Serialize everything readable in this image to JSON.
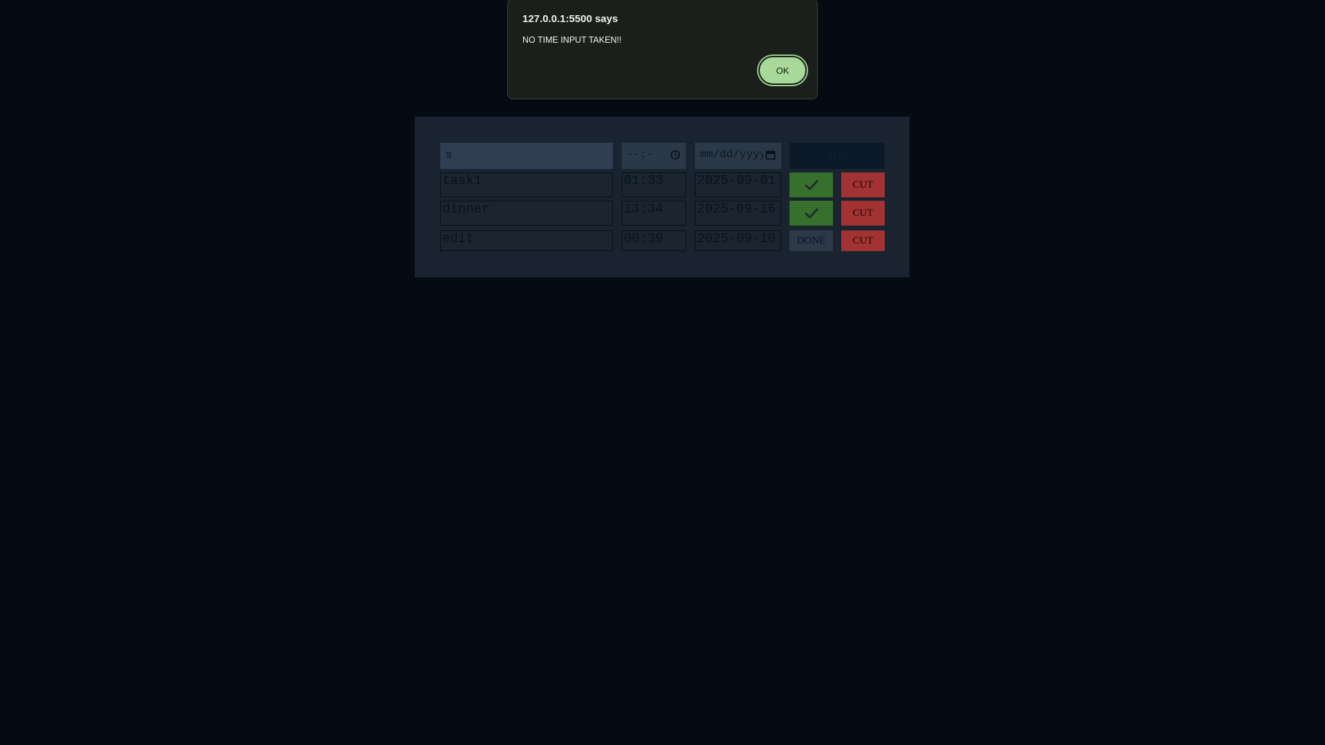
{
  "dialog": {
    "title": "127.0.0.1:5500 says",
    "message": "NO TIME INPUT TAKEN!!",
    "ok_label": "OK"
  },
  "form": {
    "task_value": "s",
    "time_placeholder": "--:-",
    "date_placeholder": "mm/dd/yyyy",
    "add_label": "ADD"
  },
  "tasks": [
    {
      "name": "task1",
      "time": "01:33",
      "date": "2025-09-01",
      "status": "done",
      "cut_label": "CUT"
    },
    {
      "name": "dinner",
      "time": "13:34",
      "date": "2025-09-16",
      "status": "done",
      "cut_label": "CUT"
    },
    {
      "name": "edit",
      "time": "00:39",
      "date": "2025-09-10",
      "status": "pending",
      "done_label": "DONE",
      "cut_label": "CUT"
    }
  ],
  "icons": {
    "check": "checkmark-icon",
    "clock": "clock-icon",
    "calendar": "calendar-icon"
  },
  "colors": {
    "background": "#040b13",
    "panel": "#1a2430",
    "check_button": "#37702d",
    "cut_button": "#a33232",
    "ok_button": "#a9d89b"
  }
}
